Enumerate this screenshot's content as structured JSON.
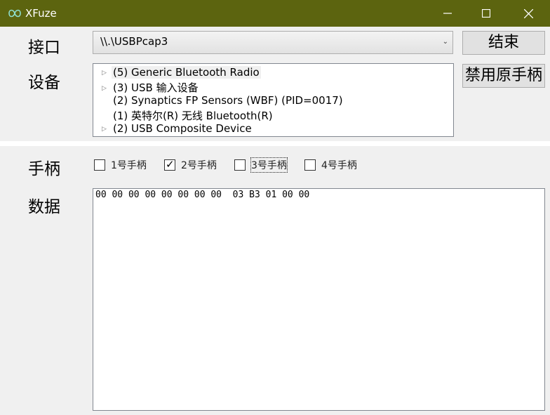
{
  "window": {
    "title": "XFuze"
  },
  "labels": {
    "interface": "接口",
    "device": "设备",
    "controller": "手柄",
    "data": "数据"
  },
  "interface_select": {
    "value": "\\\\.\\USBPcap3"
  },
  "buttons": {
    "stop": "结束",
    "disable_original": "禁用原手柄"
  },
  "device_tree": [
    {
      "label": "(5) Generic Bluetooth Radio",
      "expandable": true
    },
    {
      "label": "(3) USB 输入设备",
      "expandable": true
    },
    {
      "label": "(2) Synaptics FP Sensors (WBF) (PID=0017)",
      "expandable": false
    },
    {
      "label": "(1) 英特尔(R) 无线 Bluetooth(R)",
      "expandable": false
    },
    {
      "label": "(2) USB Composite Device",
      "expandable": true
    }
  ],
  "controllers": [
    {
      "label": "1号手柄",
      "checked": false
    },
    {
      "label": "2号手柄",
      "checked": true
    },
    {
      "label": "3号手柄",
      "checked": false
    },
    {
      "label": "4号手柄",
      "checked": false
    }
  ],
  "data_text": "00 00 00 00 00 00 00 00  03 B3 01 00 00",
  "icons": [
    "app-logo-icon",
    "minimize-icon",
    "maximize-icon",
    "close-icon",
    "dropdown-arrow-icon",
    "expand-arrow-icon",
    "checkmark-icon"
  ],
  "colors": {
    "titlebar": "#5c640f",
    "window_bg": "#f0f0f0"
  }
}
